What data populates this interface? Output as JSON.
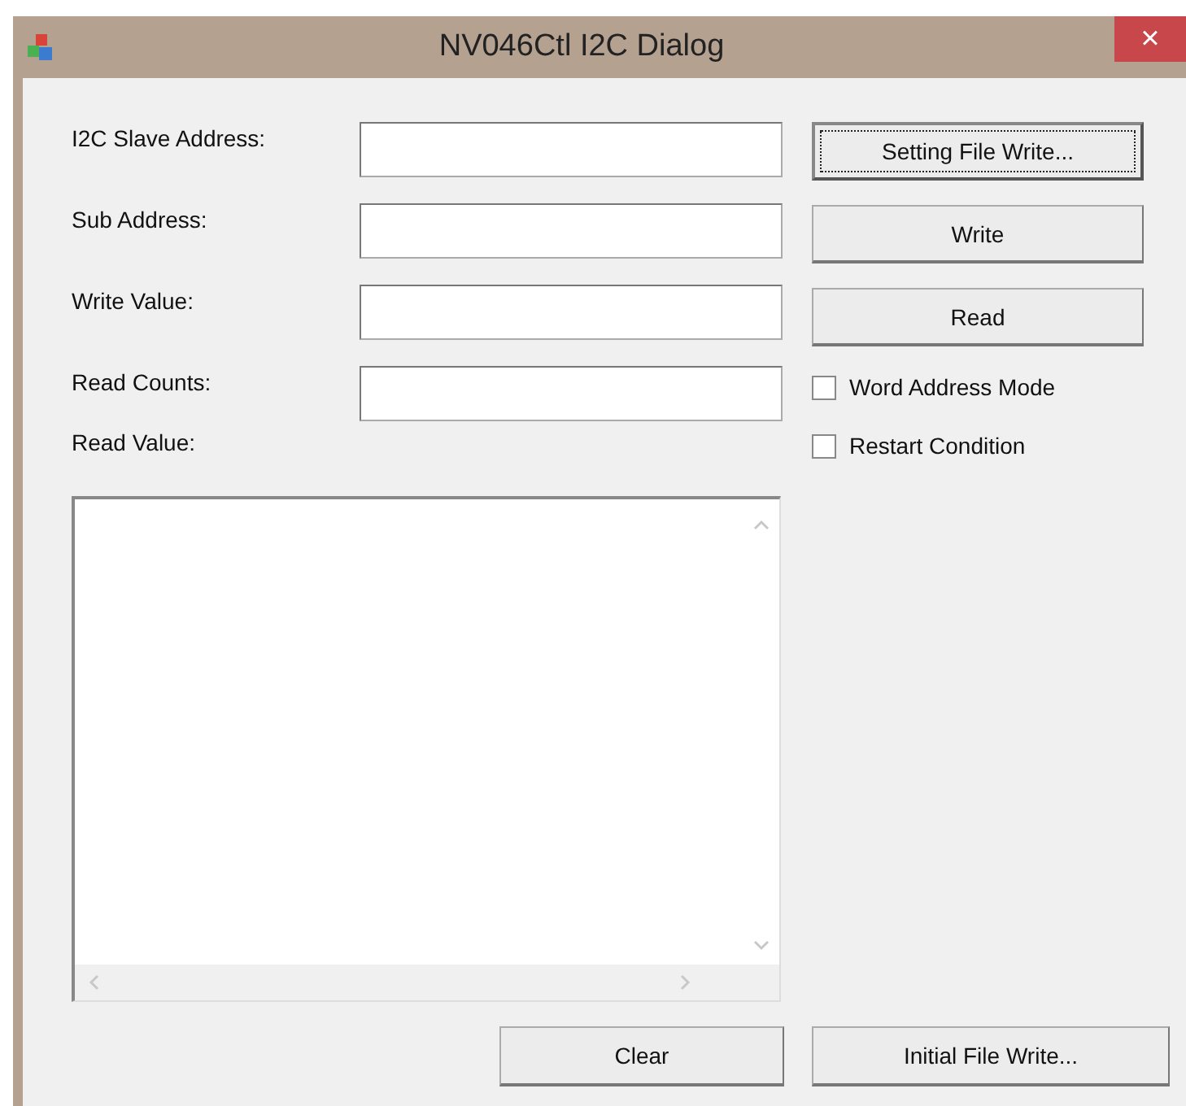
{
  "window": {
    "title": "NV046Ctl I2C Dialog",
    "close": "×"
  },
  "fields": [
    {
      "label": "I2C Slave Address:"
    },
    {
      "label": "Sub Address:"
    },
    {
      "label": "Write Value:"
    },
    {
      "label": "Read Counts:"
    }
  ],
  "side_buttons": [
    {
      "label": "Setting File Write...",
      "focused": true
    },
    {
      "label": "Write",
      "focused": false
    },
    {
      "label": "Read",
      "focused": false
    }
  ],
  "checkboxes": [
    {
      "label": "Word Address Mode",
      "checked": false
    },
    {
      "label": "Restart Condition",
      "checked": false
    }
  ],
  "read_value": {
    "label": "Read Value:"
  },
  "bottom_buttons": [
    {
      "label": "Clear"
    },
    {
      "label": "Initial File Write..."
    }
  ]
}
